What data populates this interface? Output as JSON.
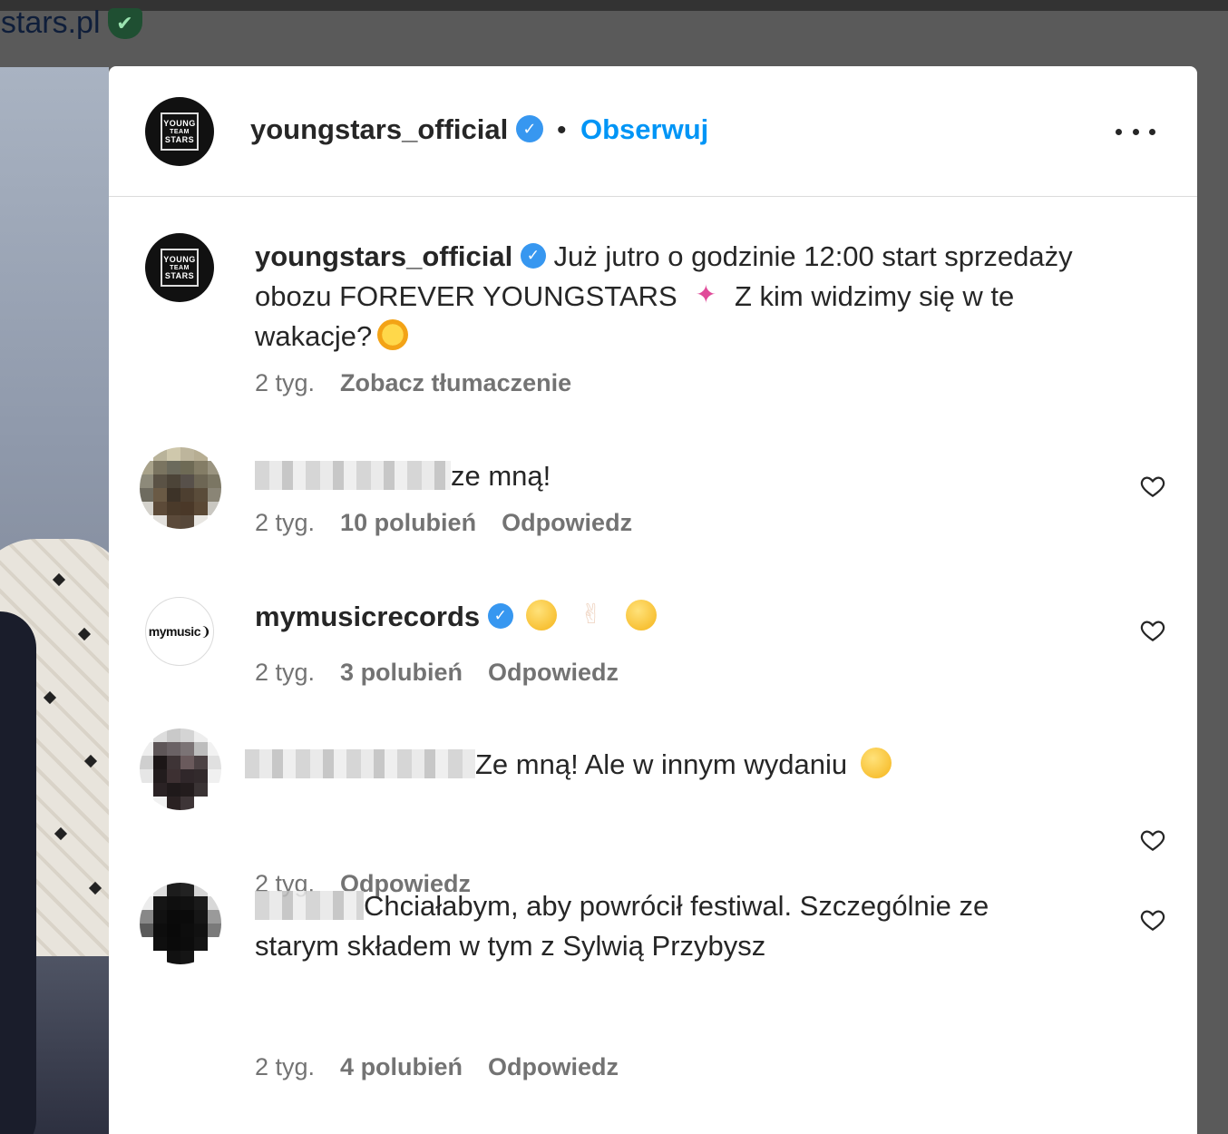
{
  "background": {
    "url_text": "gstars.pl"
  },
  "post": {
    "header": {
      "username": "youngstars_official",
      "separator": "•",
      "follow_label": "Obserwuj",
      "avatar_text": [
        "YOUNG",
        "TEAM",
        "STARS"
      ]
    },
    "caption": {
      "username": "youngstars_official",
      "text_part1": "Już jutro o godzinie 12:00 start sprzedaży obozu FOREVER YOUNGSTARS",
      "text_part2": "Z kim widzimy się w te wakacje?",
      "time": "2 tyg.",
      "translate_label": "Zobacz tłumaczenie"
    },
    "comments": [
      {
        "username_redacted": true,
        "text": "ze mną!",
        "time": "2 tyg.",
        "likes": "10 polubień",
        "reply_label": "Odpowiedz"
      },
      {
        "username": "mymusicrecords",
        "avatar_text": "mymusic",
        "verified": true,
        "text": "",
        "time": "2 tyg.",
        "likes": "3 polubień",
        "reply_label": "Odpowiedz"
      },
      {
        "username_redacted": true,
        "text": "Ze mną! Ale w innym wydaniu",
        "time": "2 tyg.",
        "reply_label": "Odpowiedz"
      },
      {
        "username_redacted": true,
        "text": "Chciałabym, aby powrócił festiwal. Szczególnie ze starym składem w tym z Sylwią Przybysz",
        "time": "2 tyg.",
        "likes": "4 polubień",
        "reply_label": "Odpowiedz"
      }
    ]
  },
  "icons": {
    "verified": "verified-badge-icon",
    "more": "more-options-icon",
    "heart": "heart-outline-icon"
  },
  "colors": {
    "follow": "#0095f6",
    "verified": "#3797f0",
    "meta": "#737373"
  }
}
